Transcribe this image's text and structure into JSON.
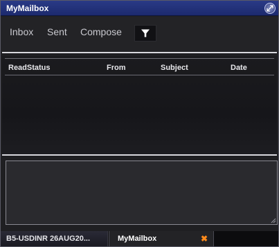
{
  "window": {
    "title": "MyMailbox",
    "expand_icon": "expand-icon"
  },
  "toolbar": {
    "inbox": "Inbox",
    "sent": "Sent",
    "compose": "Compose",
    "filter_icon": "filter-icon"
  },
  "table": {
    "columns": [
      "ReadStatus",
      "From",
      "Subject",
      "Date"
    ],
    "rows": []
  },
  "preview": {
    "text": ""
  },
  "tabs": [
    {
      "label": "B5-USDINR 26AUG20...",
      "active": false
    },
    {
      "label": "MyMailbox",
      "active": true,
      "close_glyph": "✖"
    }
  ],
  "colors": {
    "titlebar": "#1c2a6e",
    "background": "#1f1f22",
    "close_accent": "#ff8a1a"
  }
}
